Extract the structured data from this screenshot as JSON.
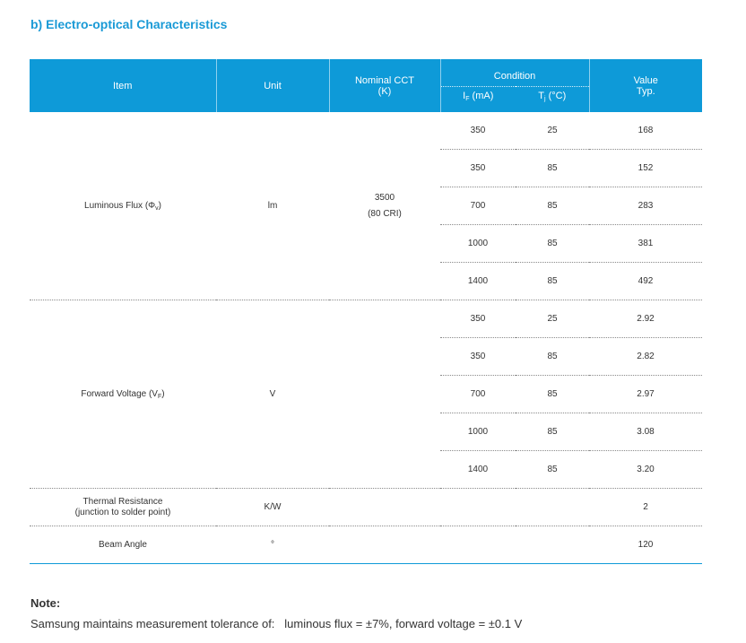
{
  "section_title": "b)  Electro-optical Characteristics",
  "headers": {
    "item": "Item",
    "unit": "Unit",
    "cct_line1": "Nominal CCT",
    "cct_line2": "(K)",
    "condition": "Condition",
    "if_main": "I",
    "if_sub": "F",
    "if_unit": " (mA)",
    "tj_main": "T",
    "tj_sub": "j",
    "tj_unit": " (°C)",
    "value_line1": "Value",
    "value_line2": "Typ."
  },
  "groups": {
    "flux": {
      "item": "Luminous Flux (Φ",
      "item_sub": "v",
      "item_end": ")",
      "unit": "lm",
      "cct_line1": "3500",
      "cct_line2": "(80 CRI)",
      "rows": [
        {
          "if": "350",
          "tj": "25",
          "val": "168"
        },
        {
          "if": "350",
          "tj": "85",
          "val": "152"
        },
        {
          "if": "700",
          "tj": "85",
          "val": "283"
        },
        {
          "if": "1000",
          "tj": "85",
          "val": "381"
        },
        {
          "if": "1400",
          "tj": "85",
          "val": "492"
        }
      ]
    },
    "voltage": {
      "item": "Forward Voltage (V",
      "item_sub": "F",
      "item_end": ")",
      "unit": "V",
      "rows": [
        {
          "if": "350",
          "tj": "25",
          "val": "2.92"
        },
        {
          "if": "350",
          "tj": "85",
          "val": "2.82"
        },
        {
          "if": "700",
          "tj": "85",
          "val": "2.97"
        },
        {
          "if": "1000",
          "tj": "85",
          "val": "3.08"
        },
        {
          "if": "1400",
          "tj": "85",
          "val": "3.20"
        }
      ]
    },
    "thermal": {
      "item_line1": "Thermal Resistance",
      "item_line2": "(junction to solder point)",
      "unit": "K/W",
      "val": "2"
    },
    "beam": {
      "item": "Beam Angle",
      "unit": "°",
      "val": "120"
    }
  },
  "note_title": "Note:",
  "note_text": "Samsung maintains measurement tolerance of:   luminous flux = ±7%, forward voltage = ±0.1 V",
  "colors": {
    "accent": "#0e9ad8",
    "title": "#1a9ad6"
  }
}
